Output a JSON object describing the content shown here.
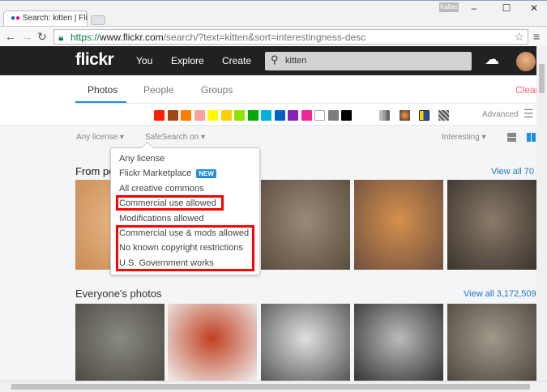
{
  "browser": {
    "tab_title": "Search: kitten | Flickr - Pho",
    "user_badge": "Kallas",
    "url_scheme": "https://",
    "url_host": "www.flickr.com",
    "url_path": "/search/?text=kitten&sort=interestingness-desc"
  },
  "header": {
    "logo": "flickr",
    "nav": [
      "You",
      "Explore",
      "Create"
    ],
    "search_value": "kitten"
  },
  "tabs": {
    "items": [
      "Photos",
      "People",
      "Groups"
    ],
    "active": "Photos",
    "clear": "Clear"
  },
  "colors": [
    "#ff2000",
    "#a24615",
    "#ff7c00",
    "#ff9f9c",
    "#fffa00",
    "#ffcf00",
    "#90e200",
    "#00ab00",
    "#00b2d4",
    "#0062c6",
    "#8c20ba",
    "#f52394",
    "#ffffff",
    "#7c7c7c",
    "#000000"
  ],
  "advanced": "Advanced",
  "filters": {
    "license": "Any license",
    "safesearch": "SafeSearch on",
    "sort": "Interesting"
  },
  "license_menu": [
    {
      "label": "Any license"
    },
    {
      "label": "Flickr Marketplace",
      "badge": "NEW"
    },
    {
      "label": "All creative commons"
    },
    {
      "label": "Commercial use allowed",
      "highlighted": true
    },
    {
      "label": "Modifications allowed"
    },
    {
      "label": "Commercial use & mods allowed",
      "highlighted": true
    },
    {
      "label": "No known copyright restrictions",
      "highlighted": true
    },
    {
      "label": "U.S. Government works",
      "highlighted": true
    }
  ],
  "sections": [
    {
      "title": "From people you follow",
      "visible_title": "From pe",
      "view_all": "View all 70"
    },
    {
      "title": "Everyone's photos",
      "view_all": "View all 3,172,509"
    }
  ],
  "accent": "#1e78c2",
  "highlight_color": "#ff0000"
}
